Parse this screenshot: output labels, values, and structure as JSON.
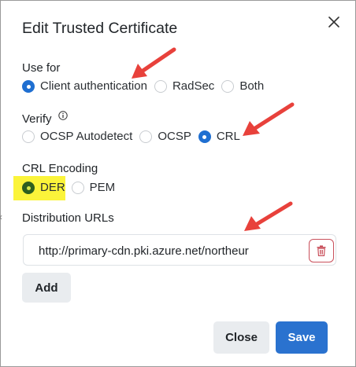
{
  "modal": {
    "title": "Edit Trusted Certificate"
  },
  "use_for": {
    "label": "Use for",
    "options": [
      "Client authentication",
      "RadSec",
      "Both"
    ],
    "selected": "Client authentication"
  },
  "verify": {
    "label": "Verify",
    "options": [
      "OCSP Autodetect",
      "OCSP",
      "CRL"
    ],
    "selected": "CRL"
  },
  "crl_encoding": {
    "label": "CRL Encoding",
    "options": [
      "DER",
      "PEM"
    ],
    "selected": "DER"
  },
  "distribution": {
    "label": "Distribution URLs",
    "url_value": "http://primary-cdn.pki.azure.net/northeur",
    "add_label": "Add"
  },
  "footer": {
    "close_label": "Close",
    "save_label": "Save"
  },
  "colors": {
    "primary": "#2a72cf",
    "radio_checked": "#1f6fd1",
    "highlight": "#fbf43a",
    "arrow": "#e8413b",
    "danger": "#c9505b"
  },
  "icons": [
    "close-icon",
    "info-icon",
    "trash-icon",
    "annotation-arrow"
  ]
}
